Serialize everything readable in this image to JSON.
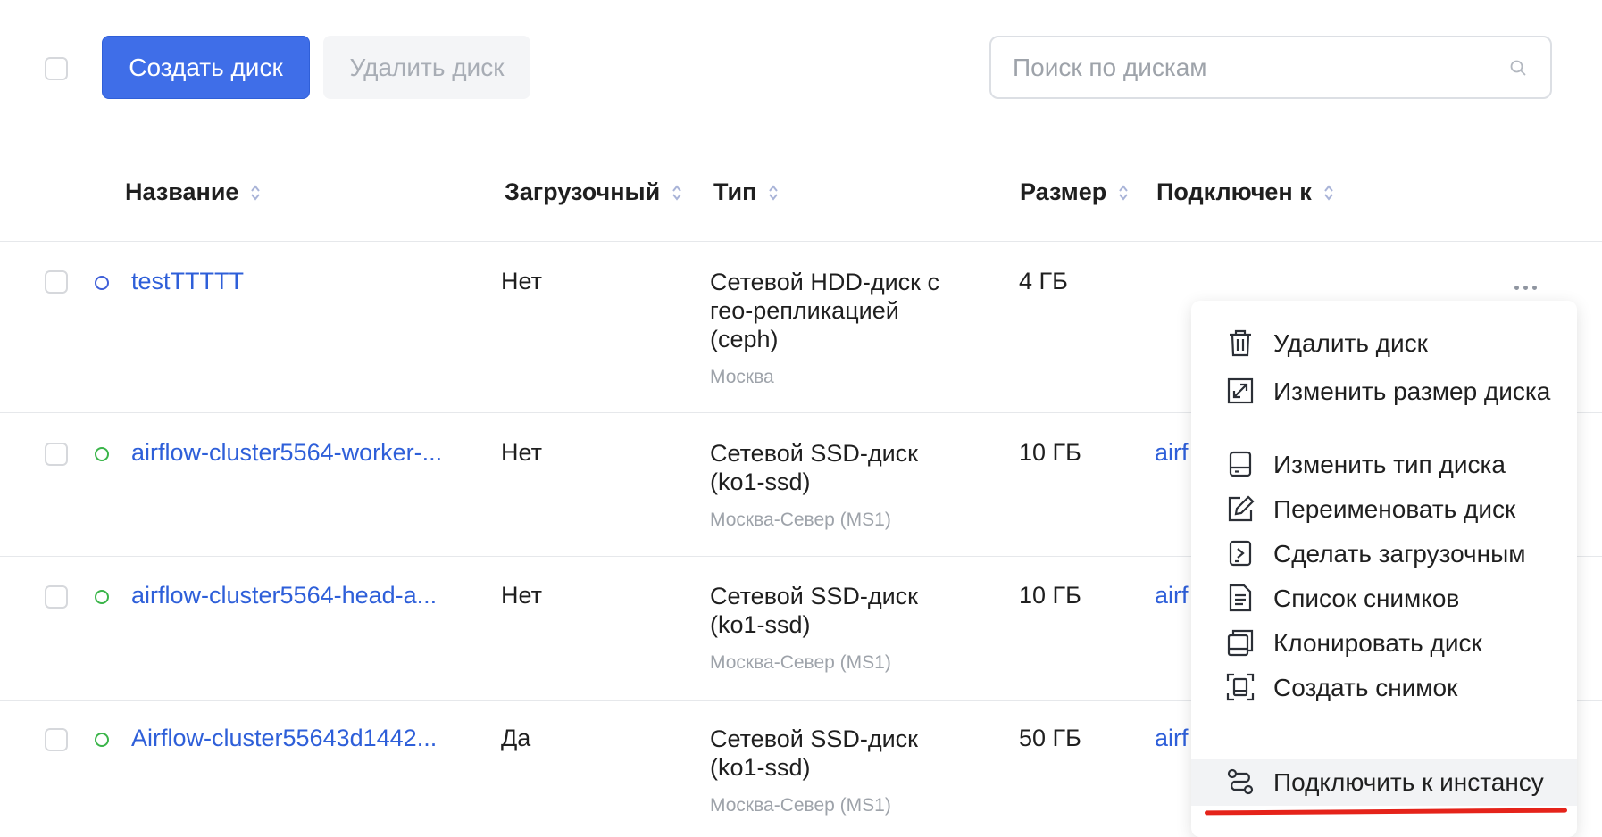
{
  "toolbar": {
    "create_label": "Создать диск",
    "delete_label": "Удалить диск",
    "search_placeholder": "Поиск по дискам"
  },
  "table": {
    "columns": [
      "Название",
      "Загрузочный",
      "Тип",
      "Размер",
      "Подключен к"
    ],
    "rows": [
      {
        "name": "testTTTTT",
        "boot": "Нет",
        "type": "Сетевой HDD-диск с гео-репликацией (ceph)",
        "region": "Москва",
        "size": "4 ГБ",
        "attached": "",
        "status_color": "#3f5fd8"
      },
      {
        "name": "airflow-cluster5564-worker-...",
        "boot": "Нет",
        "type": "Сетевой SSD-диск (ko1-ssd)",
        "region": "Москва-Север (MS1)",
        "size": "10 ГБ",
        "attached": "airf",
        "status_color": "#3bb54a"
      },
      {
        "name": "airflow-cluster5564-head-a...",
        "boot": "Нет",
        "type": "Сетевой SSD-диск (ko1-ssd)",
        "region": "Москва-Север (MS1)",
        "size": "10 ГБ",
        "attached": "airf",
        "status_color": "#3bb54a"
      },
      {
        "name": "Airflow-cluster55643d1442...",
        "boot": "Да",
        "type": "Сетевой SSD-диск (ko1-ssd)",
        "region": "Москва-Север (MS1)",
        "size": "50 ГБ",
        "attached": "airf",
        "status_color": "#3bb54a"
      }
    ]
  },
  "context_menu": {
    "items": [
      {
        "label": "Удалить диск",
        "icon": "trash-icon"
      },
      {
        "label": "Изменить размер диска",
        "icon": "resize-icon"
      },
      {
        "label": "Изменить тип диска",
        "icon": "disk-icon"
      },
      {
        "label": "Переименовать диск",
        "icon": "edit-icon"
      },
      {
        "label": "Сделать загрузочным",
        "icon": "boot-icon"
      },
      {
        "label": "Список снимков",
        "icon": "list-icon"
      },
      {
        "label": "Клонировать диск",
        "icon": "clone-icon"
      },
      {
        "label": "Создать снимок",
        "icon": "snapshot-icon"
      },
      {
        "label": "Подключить к инстансу",
        "icon": "connect-icon"
      }
    ]
  },
  "colors": {
    "primary": "#3f6ee8",
    "link": "#2e5fd9",
    "highlight": "#e5231a"
  }
}
